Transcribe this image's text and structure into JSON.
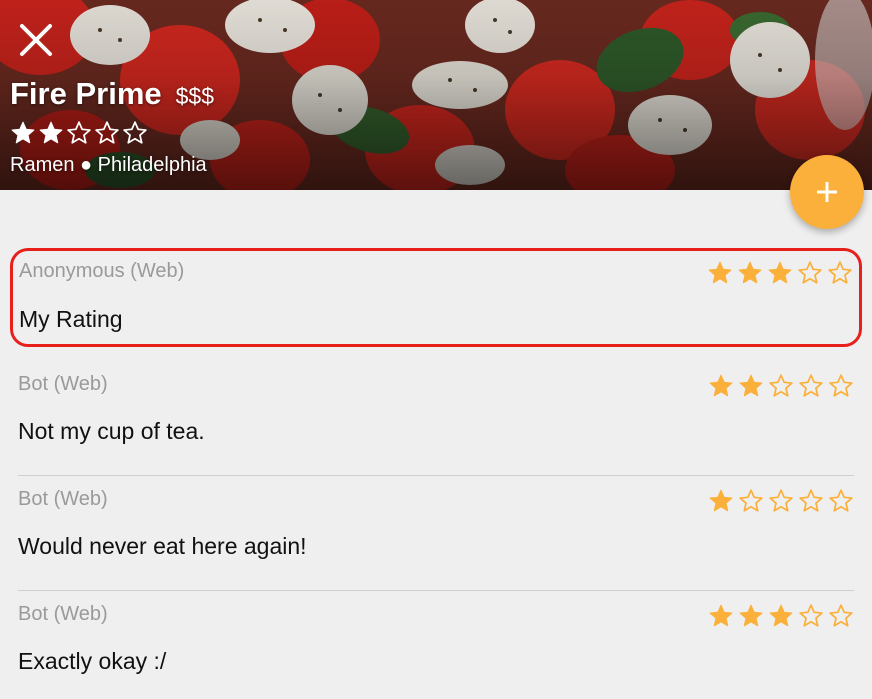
{
  "restaurant": {
    "name": "Fire Prime",
    "price": "$$$",
    "rating": 2,
    "max_rating": 5,
    "meta": "Ramen ● Philadelphia"
  },
  "header": {
    "close_icon": "close-icon",
    "add_icon": "plus-icon"
  },
  "colors": {
    "accent": "#fbb03b",
    "highlight_border": "#e8201c",
    "star_filled_hero": "#ffffff",
    "star_filled": "#fbb03b"
  },
  "reviews": [
    {
      "author": "Anonymous (Web)",
      "text": "My Rating",
      "rating": 3
    },
    {
      "author": "Bot (Web)",
      "text": "Not my cup of tea.",
      "rating": 2
    },
    {
      "author": "Bot (Web)",
      "text": "Would never eat here again!",
      "rating": 1
    },
    {
      "author": "Bot (Web)",
      "text": "Exactly okay :/",
      "rating": 3
    }
  ]
}
